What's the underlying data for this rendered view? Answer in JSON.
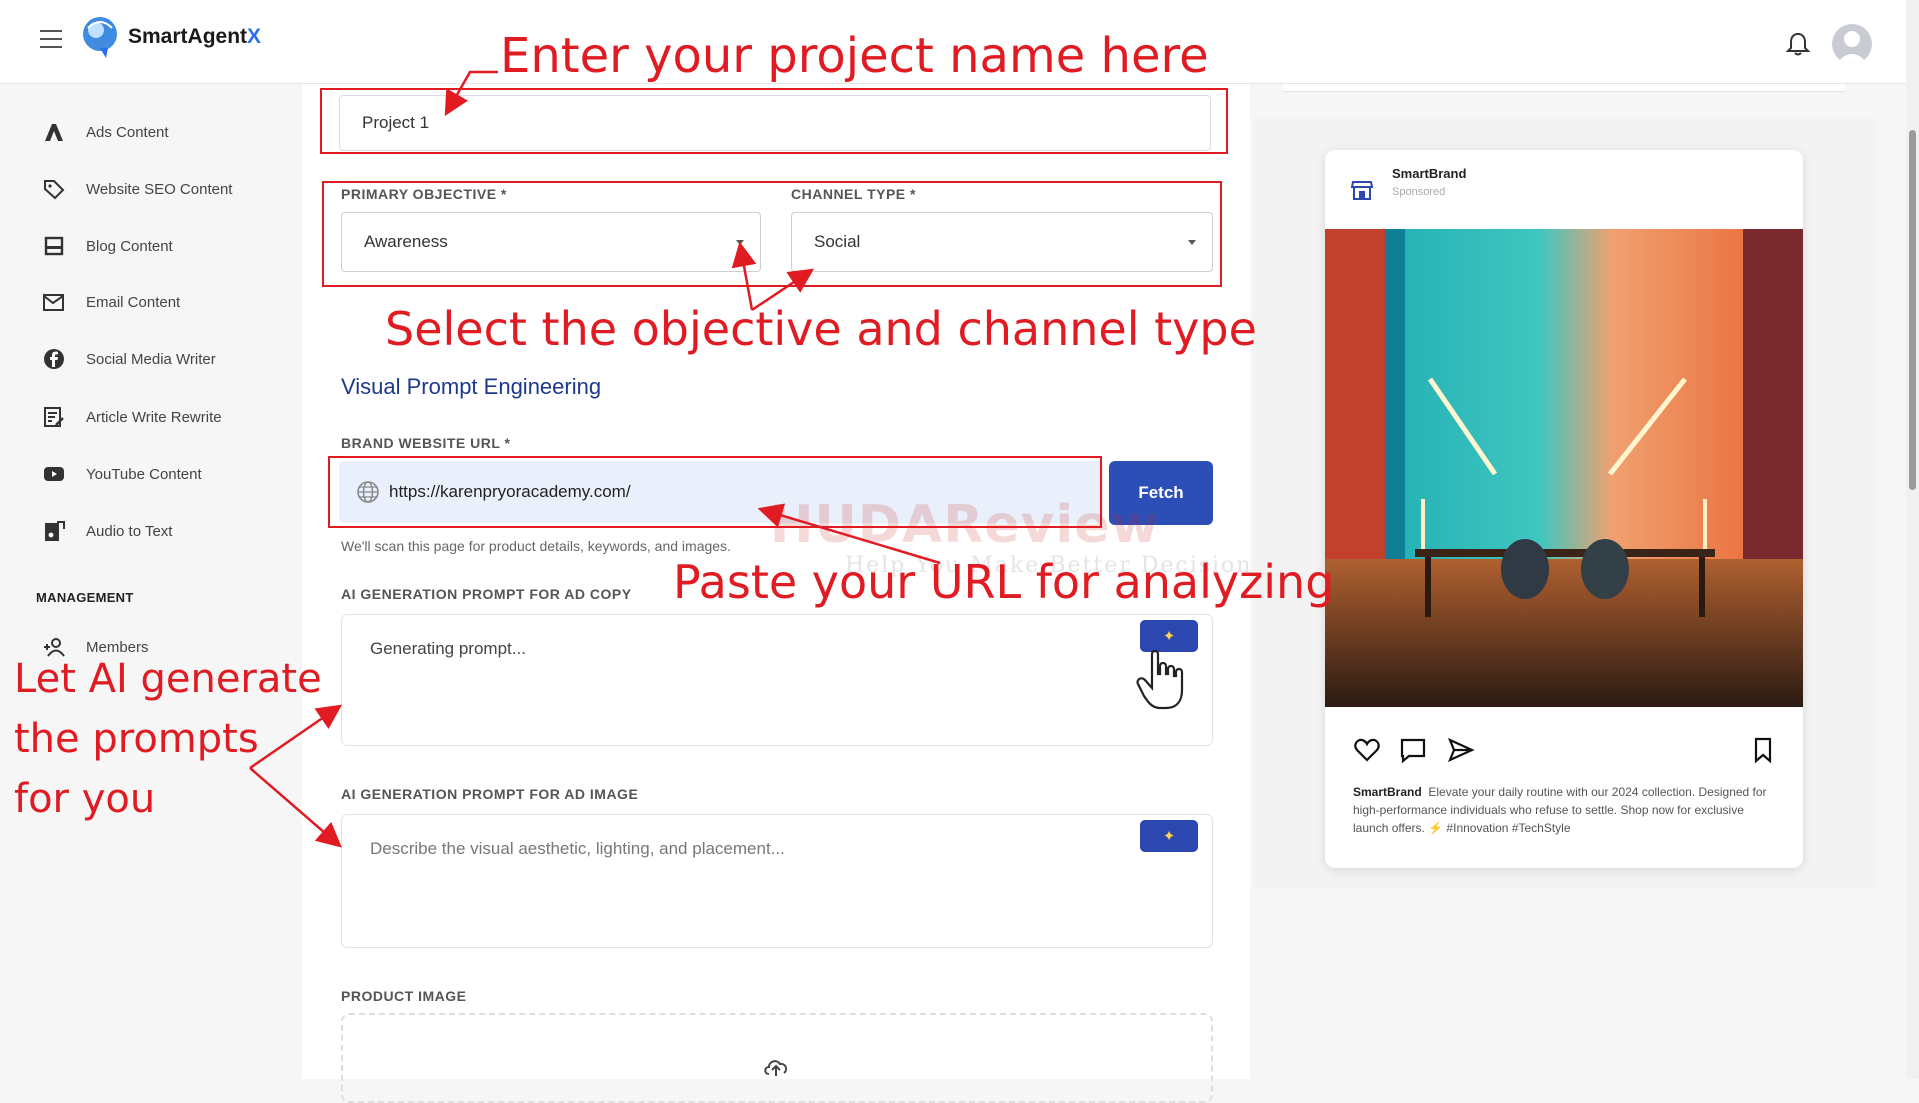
{
  "app": {
    "logo_text": "SmartAgent",
    "logo_x": "X"
  },
  "sidebar": {
    "items": [
      {
        "label": "Ads Content",
        "icon": "ads-icon"
      },
      {
        "label": "Website SEO Content",
        "icon": "tag-icon"
      },
      {
        "label": "Blog Content",
        "icon": "blog-icon"
      },
      {
        "label": "Email Content",
        "icon": "email-icon"
      },
      {
        "label": "Social Media Writer",
        "icon": "facebook-icon"
      },
      {
        "label": "Article Write Rewrite",
        "icon": "article-icon"
      },
      {
        "label": "YouTube Content",
        "icon": "youtube-icon"
      },
      {
        "label": "Audio to Text",
        "icon": "audio-icon"
      }
    ],
    "management_heading": "MANAGEMENT",
    "management_items": [
      {
        "label": "Members",
        "icon": "add-user-icon"
      }
    ]
  },
  "form": {
    "project_name": "Project 1",
    "primary_objective_label": "PRIMARY OBJECTIVE *",
    "primary_objective_value": "Awareness",
    "channel_type_label": "CHANNEL TYPE *",
    "channel_type_value": "Social",
    "section_title": "Visual Prompt Engineering",
    "brand_url_label": "BRAND WEBSITE URL *",
    "brand_url_value": "https://karenpryoracademy.com/",
    "fetch_label": "Fetch",
    "helper_text": "We'll scan this page for product details, keywords, and images.",
    "ad_copy_label": "AI GENERATION PROMPT FOR AD COPY",
    "ad_copy_value": "Generating prompt...",
    "ad_image_label": "AI GENERATION PROMPT FOR AD IMAGE",
    "ad_image_placeholder": "Describe the visual aesthetic, lighting, and placement...",
    "product_image_label": "PRODUCT IMAGE"
  },
  "preview": {
    "brand": "SmartBrand",
    "sponsored": "Sponsored",
    "caption_brand": "SmartBrand",
    "caption_text": "Elevate your daily routine with our 2024 collection. Designed for high-performance individuals who refuse to settle. Shop now for exclusive launch offers. ⚡ #Innovation #TechStyle"
  },
  "annotations": {
    "project_name": "Enter your project name here",
    "objective": "Select the objective and channel type",
    "url": "Paste your URL for analyzing",
    "ai_line1": "Let AI generate",
    "ai_line2": "the prompts",
    "ai_line3": "for you"
  },
  "watermark": {
    "main": "HUDAReview",
    "sub": "Help You Make Better Decision"
  },
  "colors": {
    "accent": "#2c4fb7",
    "annotation": "#e01b22",
    "title": "#1d3a8a"
  }
}
